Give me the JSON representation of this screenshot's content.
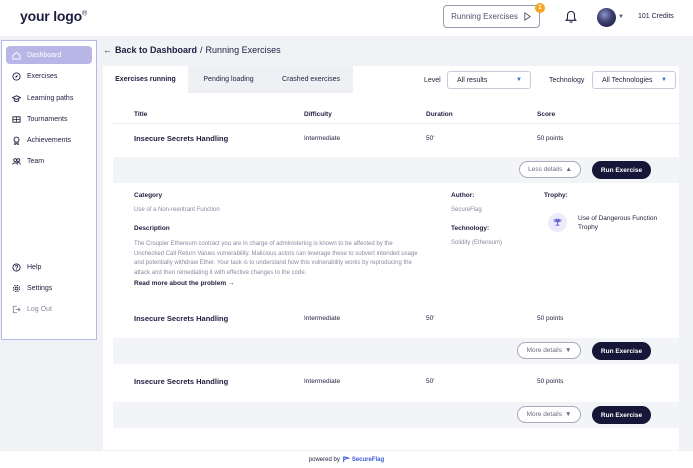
{
  "header": {
    "logo": "your logo",
    "logo_mark": "®",
    "running_label": "Running Exercises",
    "running_badge": "1",
    "credits": "101 Credits"
  },
  "sidebar": {
    "items": [
      {
        "label": "Dashboard",
        "icon": "home-icon"
      },
      {
        "label": "Exercises",
        "icon": "compass-icon"
      },
      {
        "label": "Learning paths",
        "icon": "graduation-cap-icon"
      },
      {
        "label": "Tournaments",
        "icon": "trophy-board-icon"
      },
      {
        "label": "Achievements",
        "icon": "medal-icon"
      },
      {
        "label": "Team",
        "icon": "team-icon"
      }
    ],
    "bottom": [
      {
        "label": "Help",
        "icon": "help-icon"
      },
      {
        "label": "Settings",
        "icon": "gear-icon"
      },
      {
        "label": "Log Out",
        "icon": "logout-icon"
      }
    ]
  },
  "breadcrumb": {
    "back": "Back to Dashboard",
    "separator": "/",
    "current": "Running Exercises"
  },
  "tabs": [
    "Exercises running",
    "Pending loading",
    "Crashed exercises"
  ],
  "filters": {
    "level_label": "Level",
    "level_value": "All results",
    "tech_label": "Technology",
    "tech_value": "All Technologies"
  },
  "table": {
    "headers": [
      "Title",
      "Difficulty",
      "Duration",
      "Score"
    ],
    "rows": [
      {
        "title": "Insecure Secrets Handling",
        "difficulty": "Intermediate",
        "duration": "50'",
        "score": "50 points",
        "details_label": "Less details"
      },
      {
        "title": "Insecure Secrets Handling",
        "difficulty": "Intermediate",
        "duration": "50'",
        "score": "50 points",
        "details_label": "More details"
      },
      {
        "title": "Insecure Secrets Handling",
        "difficulty": "Intermediate",
        "duration": "50'",
        "score": "50 points",
        "details_label": "More details"
      }
    ],
    "run_label": "Run Exercise"
  },
  "details": {
    "category_label": "Category",
    "category_value": "Use of a Non-reentrant Function",
    "description_label": "Description",
    "description_text": "The Croupier Ethereum contract you are in charge of administering is known to be affected by the Unchecked Call Return Values vulnerability. Malicious actors can leverage these to subvert intended usage and potentially withdraw Ether. Your task is to understand how this vulnerability works by reproducing the attack and then remediating it with effective changes to the code.",
    "read_more": "Read more about the problem",
    "author_label": "Author:",
    "author_value": "SecureFlag",
    "technology_label": "Technology:",
    "technology_value": "Solidity (Ethereum)",
    "trophy_label": "Trophy:",
    "trophy_value": "Use of Dangerous Function Trophy"
  },
  "footer": {
    "powered_by": "powered by",
    "brand": "SecureFlag"
  }
}
